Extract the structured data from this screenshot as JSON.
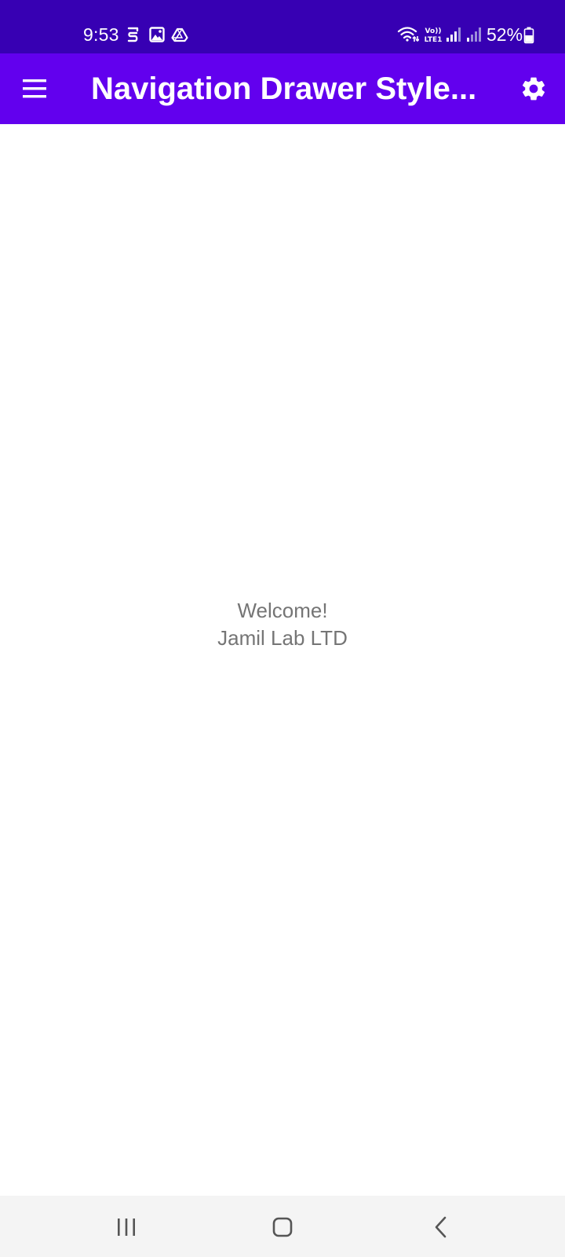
{
  "status_bar": {
    "time": "9:53",
    "battery": "52%",
    "network_label": "Vo)) LTE1",
    "icons": [
      "s-notification-icon",
      "gallery-icon",
      "drive-icon",
      "wifi-icon",
      "volte-icon",
      "signal-icon",
      "signal-icon",
      "battery-icon"
    ]
  },
  "app_bar": {
    "title": "Navigation Drawer Style...",
    "menu_icon": "hamburger-menu-icon",
    "settings_icon": "gear-icon",
    "background": "#6200ee"
  },
  "main": {
    "welcome_line1": "Welcome!",
    "welcome_line2": "Jamil Lab LTD"
  },
  "nav_bar": {
    "icons": [
      "recent-apps-icon",
      "home-icon",
      "back-icon"
    ]
  },
  "colors": {
    "status_bar": "#3700b3",
    "app_bar": "#6200ee",
    "text_secondary": "#757575",
    "nav_bar": "#f4f4f4"
  }
}
